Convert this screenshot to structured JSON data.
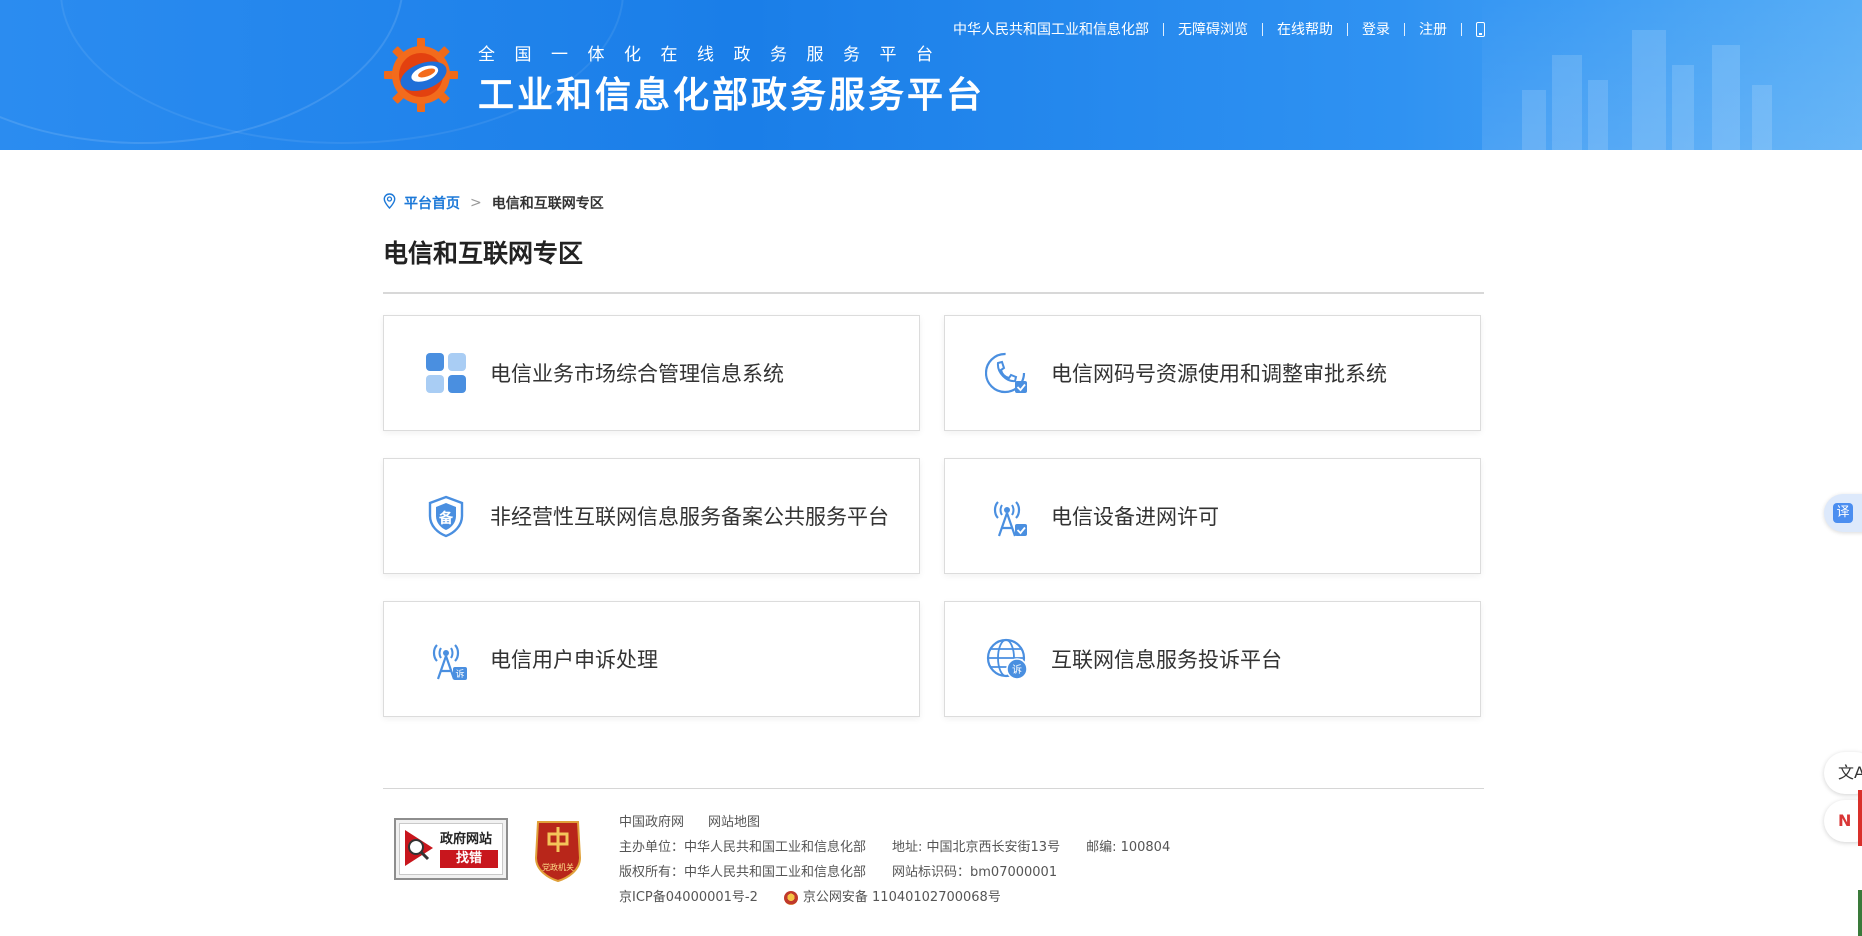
{
  "header": {
    "subtitle": "全国一体化在线政务服务平台",
    "title": "工业和信息化部政务服务平台",
    "top_links": [
      {
        "label": "中华人民共和国工业和信息化部"
      },
      {
        "label": "无障碍浏览"
      },
      {
        "label": "在线帮助"
      },
      {
        "label": "登录"
      },
      {
        "label": "注册"
      }
    ],
    "mobile_icon": "mobile-phone-icon"
  },
  "breadcrumb": {
    "home": "平台首页",
    "separator": ">",
    "current": "电信和互联网专区",
    "icon": "location-pin-icon"
  },
  "page_title": "电信和互联网专区",
  "cards": [
    {
      "label": "电信业务市场综合管理信息系统",
      "icon": "grid-blocks-icon"
    },
    {
      "label": "电信网码号资源使用和调整审批系统",
      "icon": "phone-check-icon"
    },
    {
      "label": "非经营性互联网信息服务备案公共服务平台",
      "icon": "shield-bei-icon"
    },
    {
      "label": "电信设备进网许可",
      "icon": "tower-check-icon"
    },
    {
      "label": "电信用户申诉处理",
      "icon": "tower-complaint-icon"
    },
    {
      "label": "互联网信息服务投诉平台",
      "icon": "globe-complaint-icon"
    }
  ],
  "footer": {
    "gov_badge": {
      "line1": "政府网站",
      "line2": "找错"
    },
    "party_badge": {
      "text": "党政机关"
    },
    "links": [
      "中国政府网",
      "网站地图"
    ],
    "host_label": "主办单位：中华人民共和国工业和信息化部",
    "address": "地址: 中国北京西长安街13号",
    "postcode": "邮编: 100804",
    "copyright": "版权所有：中华人民共和国工业和信息化部",
    "site_id": "网站标识码：bm07000001",
    "icp": "京ICP备04000001号-2",
    "police_record": "京公网安备 11040102700068号"
  },
  "floating": {
    "translate_glyph": "译",
    "btn1_glyph": "文A",
    "btn2_glyph": "N"
  },
  "colors": {
    "header_blue": "#1a7ee8",
    "link_blue": "#1d79d8",
    "icon_blue": "#4a8fe0",
    "badge_red": "#c8161d"
  }
}
